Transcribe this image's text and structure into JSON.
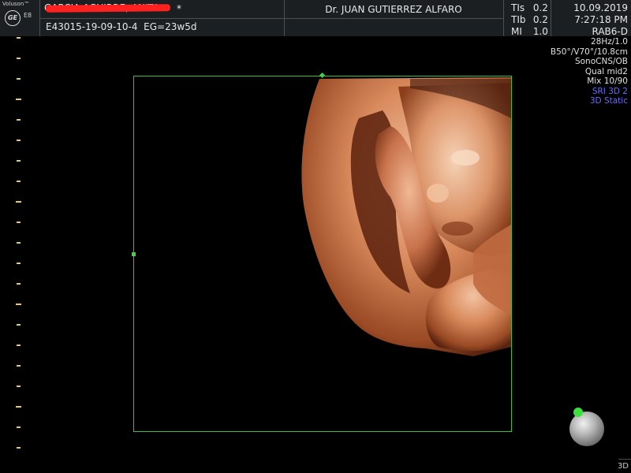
{
  "header": {
    "brand": "Voluson™",
    "logo_text": "GE",
    "model": "E8",
    "patient_name": "GARCIA AGUIRRE, ANITA",
    "modified_marker": "*",
    "exam_id": "E43015-19-09-10-4",
    "gestational_age": "EG=23w5d",
    "doctor": "Dr. JUAN GUTIERREZ ALFARO",
    "indices": [
      {
        "label": "TIs",
        "value": "0.2"
      },
      {
        "label": "TIb",
        "value": "0.2"
      },
      {
        "label": "MI",
        "value": "1.0"
      }
    ],
    "date": "10.09.2019",
    "time": "7:27:18 PM",
    "probe": "RAB6-D"
  },
  "params": [
    "28Hz/1.0",
    "B50°/V70°/10.8cm",
    "SonoCNS/OB",
    "Qual mid2",
    "Mix 10/90",
    "SRI 3D 2",
    "3D Static"
  ],
  "mode_label": "3D",
  "colors": {
    "roi_border": "#3fbf3f",
    "scale_ticks": "#e8c96c",
    "highlight_text": "#6a6aff",
    "redaction": "#ff2020"
  },
  "icons": {
    "logo": "ge-logo-icon",
    "orientation": "orientation-ball-icon"
  }
}
